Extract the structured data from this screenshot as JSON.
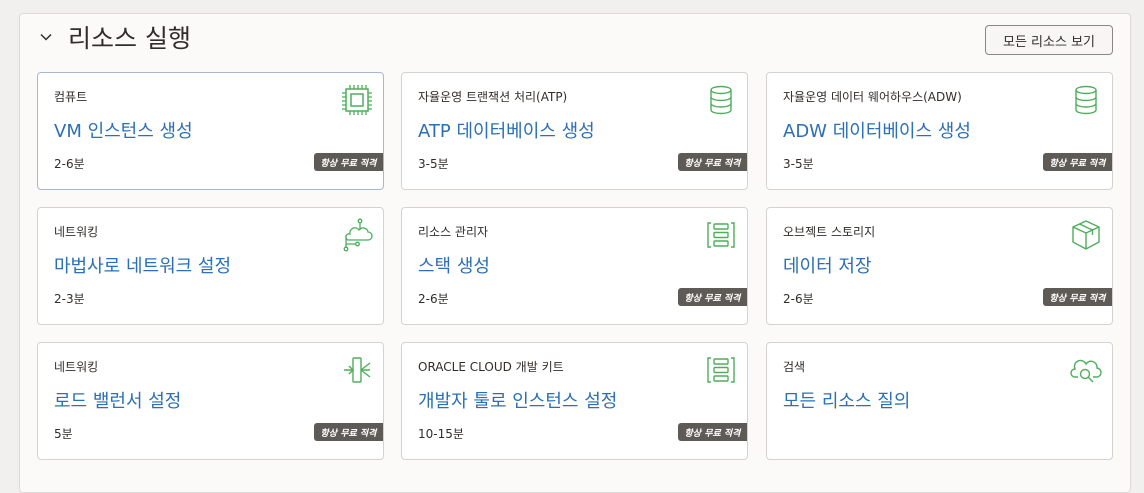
{
  "header": {
    "title": "리소스 실행",
    "view_all_label": "모든 리소스 보기"
  },
  "badge_label": "항상 무료 적격",
  "colors": {
    "link": "#2b6fb6",
    "icon_green": "#4eae5c",
    "badge_bg": "#5e5a55"
  },
  "cards": [
    {
      "category": "컴퓨트",
      "title": "VM 인스턴스 생성",
      "time": "2-6분",
      "icon": "chip-icon",
      "free_tier": true
    },
    {
      "category": "자율운영 트랜잭션 처리(ATP)",
      "title": "ATP 데이터베이스 생성",
      "time": "3-5분",
      "icon": "database-icon",
      "free_tier": true
    },
    {
      "category": "자율운영 데이터 웨어하우스(ADW)",
      "title": "ADW 데이터베이스 생성",
      "time": "3-5분",
      "icon": "database-icon",
      "free_tier": true
    },
    {
      "category": "네트워킹",
      "title": "마법사로 네트워크 설정",
      "time": "2-3분",
      "icon": "network-icon",
      "free_tier": false
    },
    {
      "category": "리소스 관리자",
      "title": "스택 생성",
      "time": "2-6분",
      "icon": "stack-icon",
      "free_tier": true
    },
    {
      "category": "오브젝트 스토리지",
      "title": "데이터 저장",
      "time": "2-6분",
      "icon": "box-icon",
      "free_tier": true
    },
    {
      "category": "네트워킹",
      "title": "로드 밸런서 설정",
      "time": "5분",
      "icon": "load-balancer-icon",
      "free_tier": true
    },
    {
      "category": "ORACLE CLOUD 개발 키트",
      "title": "개발자 툴로 인스턴스 설정",
      "time": "10-15분",
      "icon": "stack-icon",
      "free_tier": true
    },
    {
      "category": "검색",
      "title": "모든 리소스 질의",
      "time": "",
      "icon": "cloud-search-icon",
      "free_tier": false
    }
  ]
}
